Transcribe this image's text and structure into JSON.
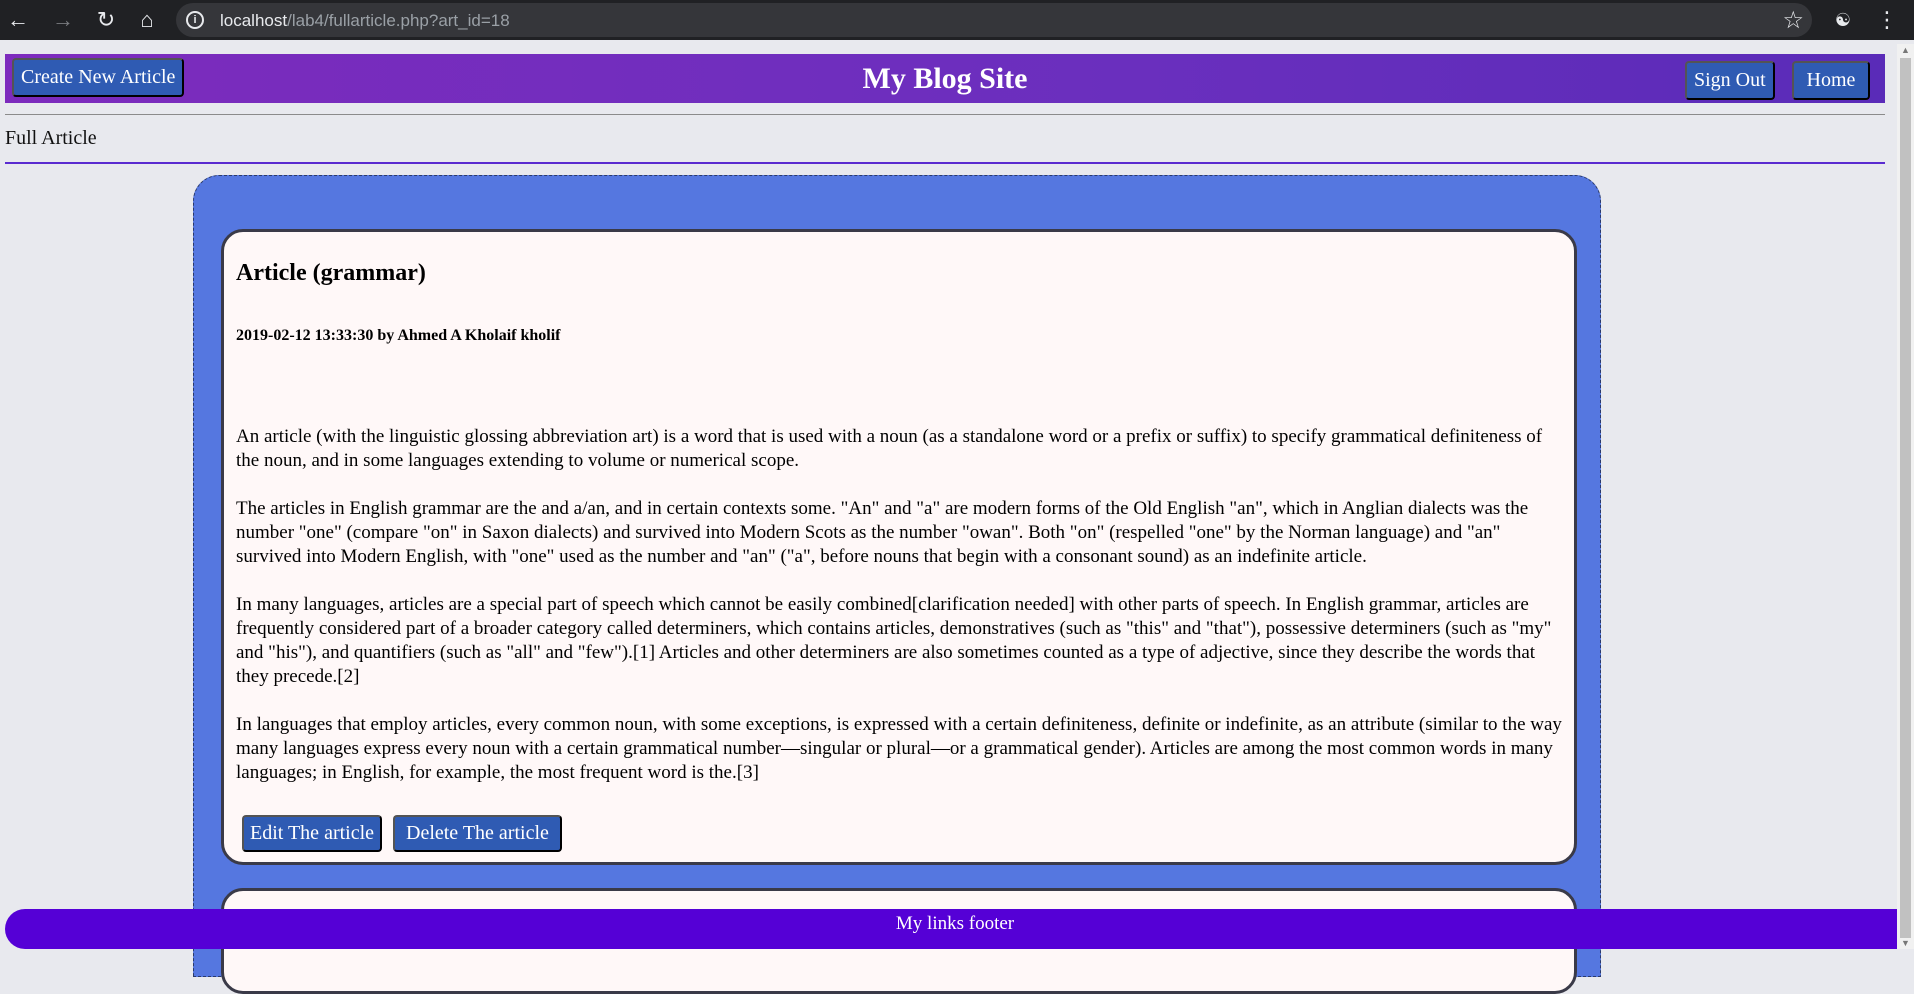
{
  "browser": {
    "url_host": "localhost",
    "url_path": "/lab4/fullarticle.php?art_id=18",
    "icons": {
      "back": "back-arrow-icon",
      "forward": "forward-arrow-icon",
      "reload": "reload-icon",
      "home": "home-icon",
      "info": "info-icon",
      "star": "star-icon",
      "extension": "incognito-icon",
      "menu": "kebab-menu-icon"
    }
  },
  "header": {
    "title": "My Blog Site",
    "create_label": "Create New Article",
    "signout_label": "Sign Out",
    "home_label": "Home"
  },
  "section": {
    "title": "Full Article"
  },
  "article": {
    "title": "Article (grammar)",
    "meta": "2019-02-12 13:33:30 by Ahmed A Kholaif kholif",
    "paragraphs": [
      "An article (with the linguistic glossing abbreviation art) is a word that is used with a noun (as a standalone word or a prefix or suffix) to specify grammatical definiteness of the noun, and in some languages extending to volume or numerical scope.",
      "The articles in English grammar are the and a/an, and in certain contexts some. \"An\" and \"a\" are modern forms of the Old English \"an\", which in Anglian dialects was the number \"one\" (compare \"on\" in Saxon dialects) and survived into Modern Scots as the number \"owan\". Both \"on\" (respelled \"one\" by the Norman language) and \"an\" survived into Modern English, with \"one\" used as the number and \"an\" (\"a\", before nouns that begin with a consonant sound) as an indefinite article.",
      "In many languages, articles are a special part of speech which cannot be easily combined[clarification needed] with other parts of speech. In English grammar, articles are frequently considered part of a broader category called determiners, which contains articles, demonstratives (such as \"this\" and \"that\"), possessive determiners (such as \"my\" and \"his\"), and quantifiers (such as \"all\" and \"few\").[1] Articles and other determiners are also sometimes counted as a type of adjective, since they describe the words that they precede.[2]",
      "In languages that employ articles, every common noun, with some exceptions, is expressed with a certain definiteness, definite or indefinite, as an attribute (similar to the way many languages express every noun with a certain grammatical number—singular or plural—or a grammatical gender). Articles are among the most common words in many languages; in English, for example, the most frequent word is the.[3]"
    ],
    "edit_label": "Edit The article",
    "delete_label": "Delete The article"
  },
  "footer": {
    "text": "My links footer"
  },
  "colors": {
    "header_purple": "#6a2fbe",
    "button_blue": "#2f5bb3",
    "container_blue": "#5577e0",
    "footer_purple": "#5500d6"
  }
}
